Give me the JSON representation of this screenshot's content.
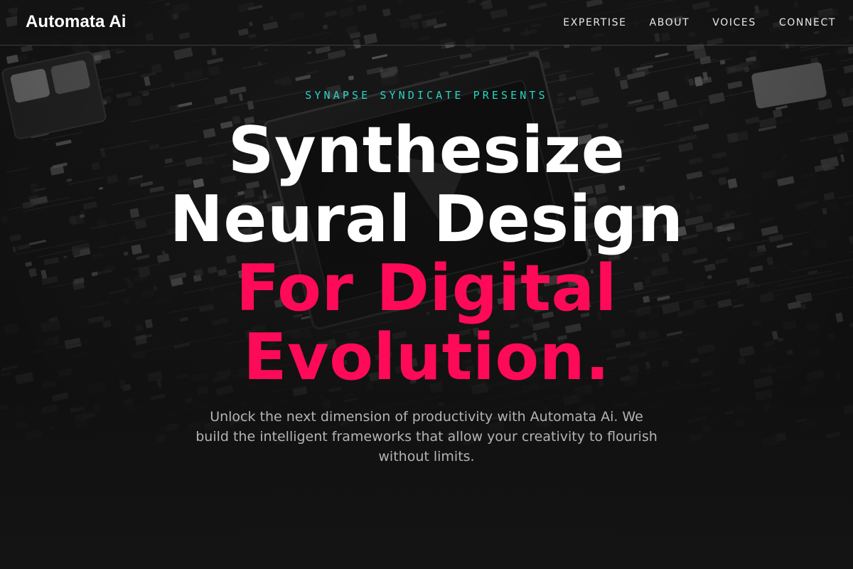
{
  "nav": {
    "logo": "Automata Ai",
    "links": [
      {
        "label": "EXPERTISE"
      },
      {
        "label": "ABOUT"
      },
      {
        "label": "VOICES"
      },
      {
        "label": "CONNECT"
      }
    ]
  },
  "hero": {
    "eyebrow": "SYNAPSE SYNDICATE PRESENTS",
    "headline": {
      "line1": "Synthesize",
      "line2": "Neural Design",
      "line3": "For Digital",
      "line4": "Evolution."
    },
    "description": "Unlock the next dimension of productivity with Automata Ai. We build the intelligent frameworks that allow your creativity to flourish without limits."
  },
  "colors": {
    "accent_pink": "#ff0a58",
    "accent_teal": "#2ad3c4",
    "background": "#141414",
    "text_white": "#ffffff"
  }
}
